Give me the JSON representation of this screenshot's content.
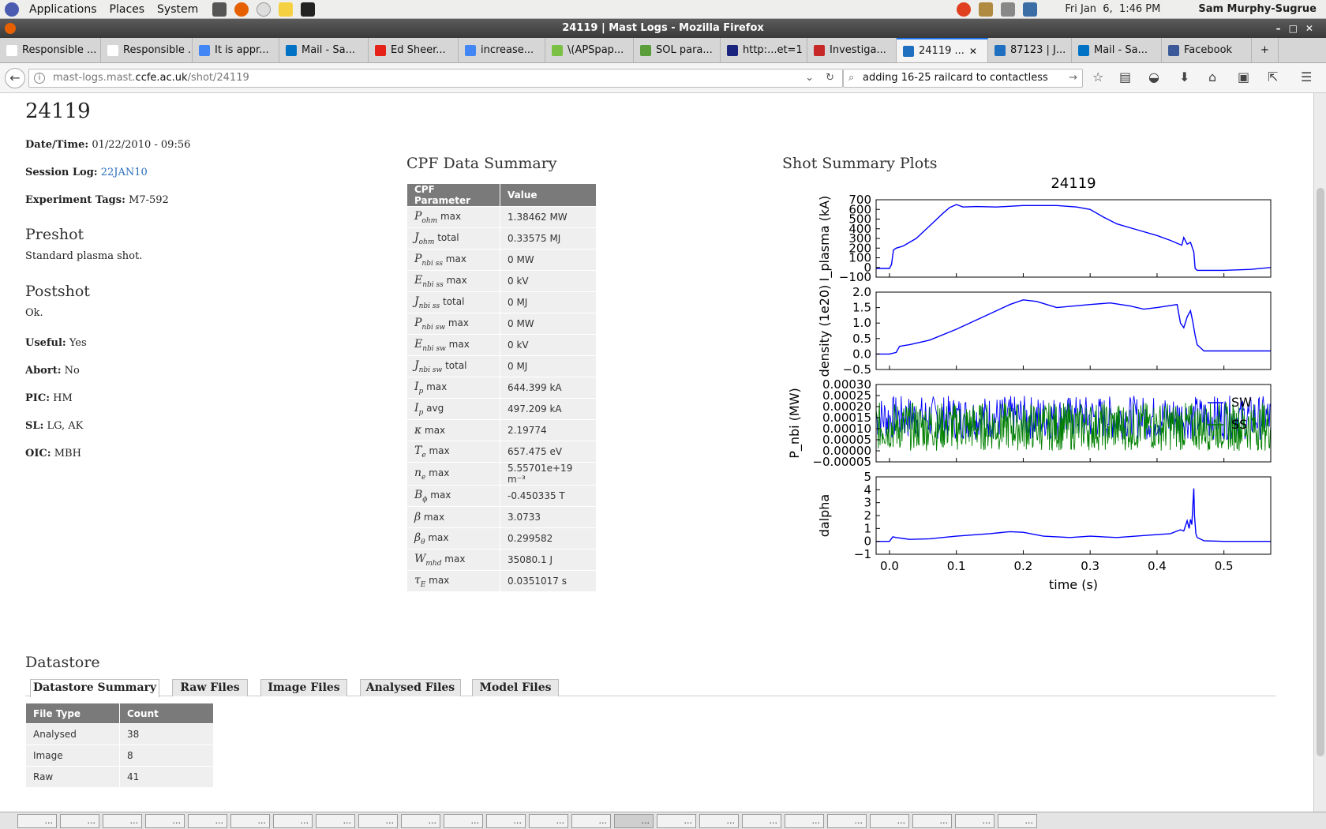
{
  "top_panel": {
    "menus": [
      "Applications",
      "Places",
      "System"
    ],
    "datetime": "Fri Jan  6,  1:46 PM",
    "user": "Sam Murphy-Sugrue"
  },
  "window": {
    "title": "24119 | Mast Logs - Mozilla Firefox"
  },
  "tabs": [
    {
      "label": "Responsible ...",
      "color": "#ffffff"
    },
    {
      "label": "Responsible ...",
      "color": "#ffffff"
    },
    {
      "label": "It is appr...",
      "color": "#4285f4"
    },
    {
      "label": "Mail - Sa...",
      "color": "#0072c6"
    },
    {
      "label": "Ed Sheer...",
      "color": "#e62117"
    },
    {
      "label": "increase...",
      "color": "#4285f4"
    },
    {
      "label": "\\(APSpap...",
      "color": "#7ac143"
    },
    {
      "label": "SOL para...",
      "color": "#5a9e3a"
    },
    {
      "label": "http:...et=1",
      "color": "#1a237e"
    },
    {
      "label": "Investiga...",
      "color": "#c62828"
    },
    {
      "label": "24119 ...",
      "color": "#1e6fc0",
      "active": true
    },
    {
      "label": "87123 | J...",
      "color": "#1e6fc0"
    },
    {
      "label": "Mail - Sa...",
      "color": "#0072c6"
    },
    {
      "label": "Facebook",
      "color": "#3b5998"
    }
  ],
  "nav": {
    "url_prefix": "mast-logs.mast.",
    "url_host": "ccfe.ac.uk",
    "url_path": "/shot/24119",
    "search_value": "adding 16-25 railcard to contactless"
  },
  "shot": {
    "number": "24119",
    "datetime_label": "Date/Time:",
    "datetime": "01/22/2010 - 09:56",
    "session_label": "Session Log:",
    "session": "22JAN10",
    "tags_label": "Experiment Tags:",
    "tags": "M7-592",
    "preshot_heading": "Preshot",
    "preshot": "Standard plasma shot.",
    "postshot_heading": "Postshot",
    "postshot": "Ok.",
    "useful_label": "Useful:",
    "useful": "Yes",
    "abort_label": "Abort:",
    "abort": "No",
    "pic_label": "PIC:",
    "pic": "HM",
    "sl_label": "SL:",
    "sl": "LG, AK",
    "oic_label": "OIC:",
    "oic": "MBH"
  },
  "cpf": {
    "heading": "CPF Data Summary",
    "col_param": "CPF Parameter",
    "col_value": "Value",
    "rows": [
      {
        "sym": "P",
        "sub": "ohm",
        "suffix": " max",
        "value": "1.38462 MW"
      },
      {
        "sym": "J",
        "sub": "ohm",
        "suffix": " total",
        "value": "0.33575 MJ"
      },
      {
        "sym": "P",
        "sub": "nbi ss",
        "suffix": " max",
        "value": "0 MW"
      },
      {
        "sym": "E",
        "sub": "nbi ss",
        "suffix": " max",
        "value": "0 kV"
      },
      {
        "sym": "J",
        "sub": "nbi ss",
        "suffix": " total",
        "value": "0 MJ"
      },
      {
        "sym": "P",
        "sub": "nbi sw",
        "suffix": " max",
        "value": "0 MW"
      },
      {
        "sym": "E",
        "sub": "nbi sw",
        "suffix": " max",
        "value": "0 kV"
      },
      {
        "sym": "J",
        "sub": "nbi sw",
        "suffix": " total",
        "value": "0 MJ"
      },
      {
        "sym": "I",
        "sub": "p",
        "suffix": " max",
        "value": "644.399 kA"
      },
      {
        "sym": "I",
        "sub": "p",
        "suffix": " avg",
        "value": "497.209 kA"
      },
      {
        "sym": "κ",
        "sub": "",
        "suffix": " max",
        "value": "2.19774"
      },
      {
        "sym": "T",
        "sub": "e",
        "suffix": " max",
        "value": "657.475 eV"
      },
      {
        "sym": "n",
        "sub": "e",
        "suffix": " max",
        "value": "5.55701e+19 m⁻³"
      },
      {
        "sym": "B",
        "sub": "ϕ",
        "suffix": " max",
        "value": "-0.450335 T"
      },
      {
        "sym": "β",
        "sub": "",
        "suffix": " max",
        "value": "3.0733"
      },
      {
        "sym": "β",
        "sub": "θ",
        "suffix": " max",
        "value": "0.299582"
      },
      {
        "sym": "W",
        "sub": "mhd",
        "suffix": " max",
        "value": "35080.1 J"
      },
      {
        "sym": "τ",
        "sub": "E",
        "suffix": " max",
        "value": "0.0351017 s"
      }
    ]
  },
  "plots_heading": "Shot Summary Plots",
  "chart_data": {
    "type": "line",
    "title": "24119",
    "xlabel": "time (s)",
    "xlim": [
      -0.02,
      0.57
    ],
    "xticks": [
      "0.0",
      "0.1",
      "0.2",
      "0.3",
      "0.4",
      "0.5"
    ],
    "panels": [
      {
        "ylabel": "I_plasma (kA)",
        "ylim": [
          -100,
          700
        ],
        "yticks": [
          "700",
          "600",
          "500",
          "400",
          "300",
          "200",
          "100",
          "0",
          "−100"
        ],
        "series": [
          {
            "color": "#0000ff",
            "x": [
              -0.02,
              0.0,
              0.003,
              0.006,
              0.01,
              0.02,
              0.04,
              0.06,
              0.08,
              0.09,
              0.1,
              0.11,
              0.13,
              0.16,
              0.2,
              0.25,
              0.28,
              0.3,
              0.32,
              0.34,
              0.37,
              0.4,
              0.42,
              0.43,
              0.437,
              0.44,
              0.445,
              0.45,
              0.455,
              0.457,
              0.46,
              0.5,
              0.54,
              0.57
            ],
            "y": [
              -10,
              -10,
              30,
              180,
              200,
              220,
              300,
              430,
              560,
              620,
              650,
              625,
              630,
              625,
              640,
              640,
              625,
              600,
              520,
              450,
              390,
              330,
              280,
              250,
              230,
              310,
              240,
              260,
              160,
              -10,
              -30,
              -30,
              -20,
              0
            ]
          }
        ]
      },
      {
        "ylabel": "density (1e20)",
        "ylim": [
          -0.5,
          2.0
        ],
        "yticks": [
          "2.0",
          "1.5",
          "1.0",
          "0.5",
          "0.0",
          "−0.5"
        ],
        "series": [
          {
            "color": "#0000ff",
            "x": [
              -0.02,
              0.0,
              0.01,
              0.015,
              0.03,
              0.06,
              0.1,
              0.14,
              0.18,
              0.2,
              0.22,
              0.25,
              0.3,
              0.33,
              0.36,
              0.38,
              0.4,
              0.43,
              0.435,
              0.44,
              0.445,
              0.45,
              0.453,
              0.457,
              0.46,
              0.47,
              0.5,
              0.54,
              0.57
            ],
            "y": [
              0.0,
              0.0,
              0.05,
              0.25,
              0.3,
              0.45,
              0.8,
              1.2,
              1.6,
              1.75,
              1.7,
              1.5,
              1.6,
              1.65,
              1.55,
              1.45,
              1.5,
              1.6,
              1.0,
              0.85,
              1.2,
              1.4,
              1.1,
              0.6,
              0.3,
              0.1,
              0.1,
              0.1,
              0.1
            ]
          }
        ]
      },
      {
        "ylabel": "P_nbi (MW)",
        "ylim": [
          -5e-05,
          0.0003
        ],
        "yticks": [
          "0.00030",
          "0.00025",
          "0.00020",
          "0.00015",
          "0.00010",
          "0.00005",
          "0.00000",
          "−0.00005"
        ],
        "series": [
          {
            "name": "SW",
            "color": "#0000ff",
            "noise": {
              "low": 5e-05,
              "high": 0.00025,
              "count": 520
            }
          },
          {
            "name": "SS",
            "color": "#008000",
            "noise": {
              "low": 0.0,
              "high": 0.00022,
              "count": 700
            }
          }
        ]
      },
      {
        "ylabel": "dalpha",
        "ylim": [
          -1,
          5
        ],
        "yticks": [
          "5",
          "4",
          "3",
          "2",
          "1",
          "0",
          "−1"
        ],
        "series": [
          {
            "color": "#0000ff",
            "x": [
              -0.02,
              0.0,
              0.005,
              0.01,
              0.03,
              0.06,
              0.1,
              0.15,
              0.18,
              0.2,
              0.23,
              0.27,
              0.3,
              0.34,
              0.38,
              0.42,
              0.435,
              0.44,
              0.445,
              0.448,
              0.45,
              0.452,
              0.455,
              0.456,
              0.458,
              0.46,
              0.47,
              0.5,
              0.57
            ],
            "y": [
              0.0,
              0.0,
              0.35,
              0.3,
              0.15,
              0.2,
              0.4,
              0.6,
              0.75,
              0.7,
              0.4,
              0.3,
              0.4,
              0.3,
              0.45,
              0.6,
              0.9,
              0.8,
              1.6,
              1.0,
              1.7,
              1.3,
              4.1,
              2.0,
              0.6,
              0.3,
              0.05,
              0.0,
              0.0
            ]
          }
        ]
      }
    ]
  },
  "datastore": {
    "heading": "Datastore",
    "tabs": [
      "Datastore Summary",
      "Raw Files",
      "Image Files",
      "Analysed Files",
      "Model Files"
    ],
    "col_type": "File Type",
    "col_count": "Count",
    "rows": [
      {
        "type": "Analysed",
        "count": "38"
      },
      {
        "type": "Image",
        "count": "8"
      },
      {
        "type": "Raw",
        "count": "41"
      }
    ]
  },
  "taskbar": {
    "items": 24,
    "item_label": "..."
  }
}
